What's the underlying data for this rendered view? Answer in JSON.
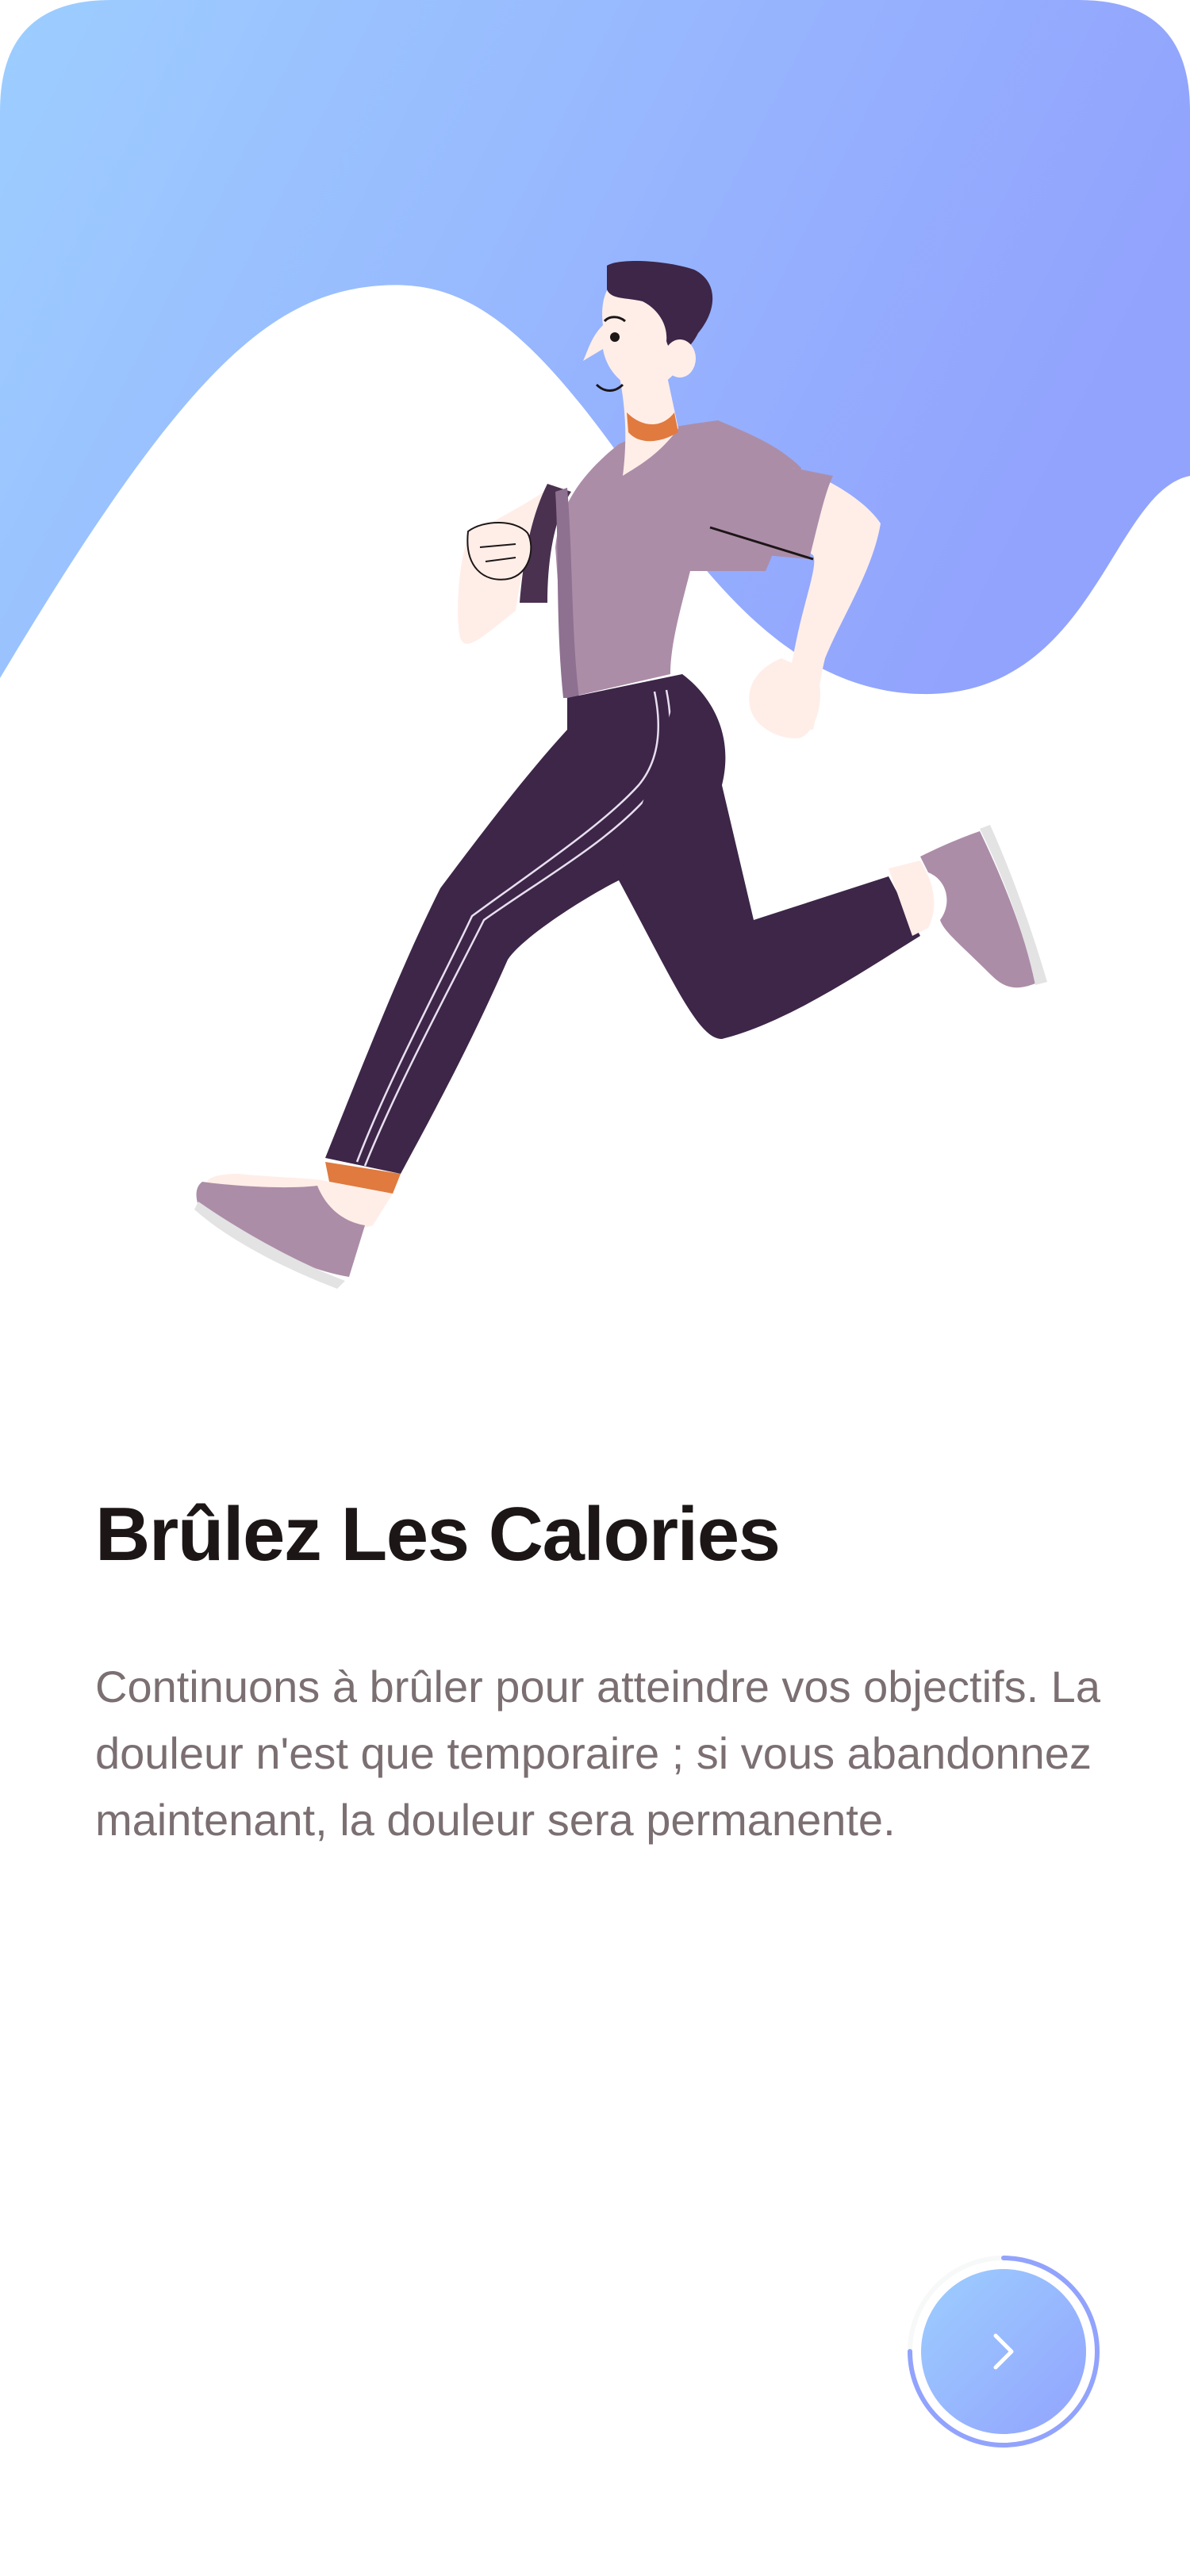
{
  "onboarding": {
    "title": "Brûlez Les Calories",
    "description": "Continuons à brûler pour atteindre vos objectifs. La douleur n'est que temporaire ; si vous abandonnez maintenant, la douleur sera permanente.",
    "progress": 0.75
  },
  "colors": {
    "gradient_start": "#9DCEFF",
    "gradient_end": "#92A3FD",
    "title": "#1D1617",
    "body_text": "#7B6F72"
  },
  "icons": {
    "illustration": "running-man-illustration",
    "next": "chevron-right-icon"
  }
}
